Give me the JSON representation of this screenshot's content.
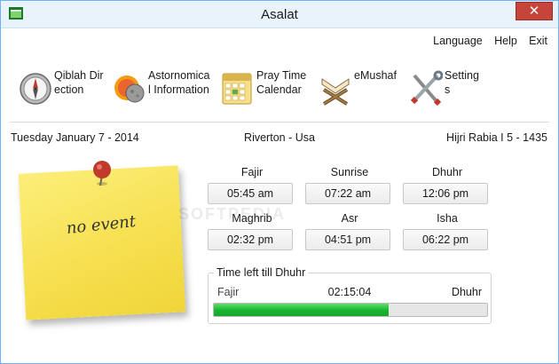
{
  "window": {
    "title": "Asalat",
    "close_glyph": "✕",
    "app_icon": "app-icon"
  },
  "menu": {
    "items": [
      "Language",
      "Help",
      "Exit"
    ]
  },
  "toolbar": {
    "items": [
      {
        "label": "Qiblah Direction",
        "icon": "compass-icon"
      },
      {
        "label": "Astornomical Information",
        "icon": "astronomy-icon"
      },
      {
        "label": "Pray Time Calendar",
        "icon": "calendar-icon"
      },
      {
        "label": "eMushaf",
        "icon": "quran-stand-icon"
      },
      {
        "label": "Settings",
        "icon": "tools-icon"
      }
    ]
  },
  "info": {
    "date": "Tuesday January 7 - 2014",
    "location": "Riverton - Usa",
    "hijri": "Hijri Rabia I 5 - 1435"
  },
  "note": {
    "text": "no event"
  },
  "prayers": [
    {
      "name": "Fajir",
      "time": "05:45 am"
    },
    {
      "name": "Sunrise",
      "time": "07:22 am"
    },
    {
      "name": "Dhuhr",
      "time": "12:06 pm"
    },
    {
      "name": "Maghrib",
      "time": "02:32 pm"
    },
    {
      "name": "Asr",
      "time": "04:51 pm"
    },
    {
      "name": "Isha",
      "time": "06:22 pm"
    }
  ],
  "countdown": {
    "title": "Time left till Dhuhr",
    "from": "Fajir",
    "remaining": "02:15:04",
    "to": "Dhuhr",
    "progress_fraction": 0.64
  },
  "watermark": "SOFTPEDIA",
  "colors": {
    "accent": "#6fb1ff",
    "progress": "#16b52a",
    "note": "#f6df4d",
    "close": "#c7443a"
  }
}
